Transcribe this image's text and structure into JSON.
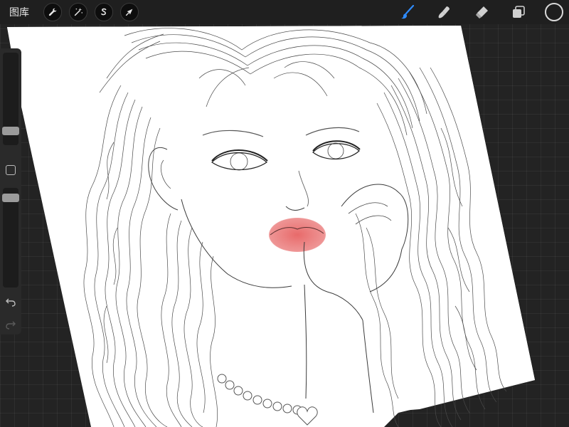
{
  "topbar": {
    "gallery_label": "图库",
    "left_tools": [
      {
        "icon": "wrench-icon",
        "name": "actions"
      },
      {
        "icon": "magic-wand-icon",
        "name": "adjustments"
      },
      {
        "icon": "selection-s-icon",
        "name": "selection"
      },
      {
        "icon": "arrow-cursor-icon",
        "name": "transform"
      }
    ],
    "right_tools": [
      {
        "icon": "brush-icon",
        "name": "brush",
        "active": true
      },
      {
        "icon": "smudge-icon",
        "name": "smudge"
      },
      {
        "icon": "eraser-icon",
        "name": "eraser"
      },
      {
        "icon": "layers-icon",
        "name": "layers"
      },
      {
        "icon": "color-circle-icon",
        "name": "color"
      }
    ]
  },
  "sidebar": {
    "brush_size_level": 0.82,
    "opacity_level": 0.95
  },
  "colors": {
    "active_tool": "#2f8cff",
    "lips": "#e86a6a",
    "line": "#3a3a3a",
    "paper": "#ffffff"
  }
}
